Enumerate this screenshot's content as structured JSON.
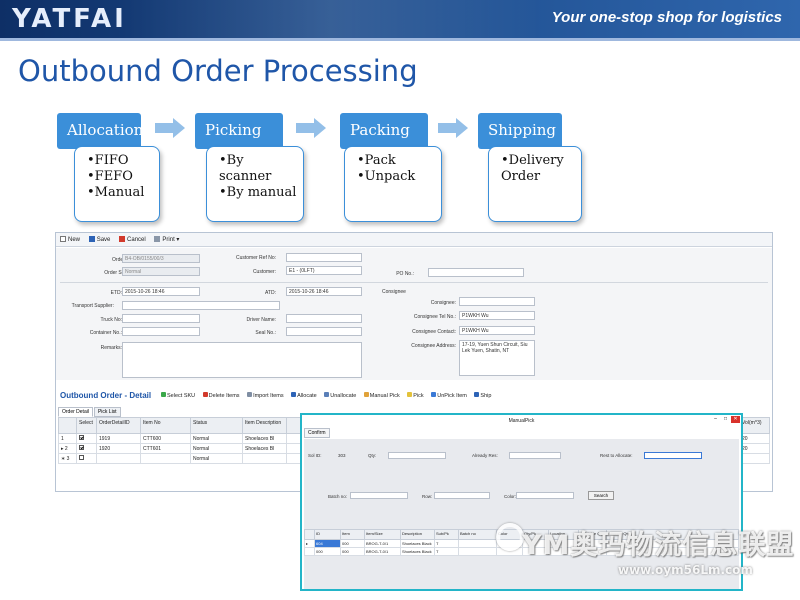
{
  "header": {
    "logo": "YATFAI",
    "tagline": "Your one-stop shop for logistics"
  },
  "page_title": "Outbound Order Processing",
  "stages": [
    {
      "title": "Allocation",
      "items": [
        "FIFO",
        "FEFO",
        "Manual"
      ]
    },
    {
      "title": "Picking",
      "items": [
        "By scanner",
        "By manual"
      ]
    },
    {
      "title": "Packing",
      "items": [
        "Pack",
        "Unpack"
      ]
    },
    {
      "title": "Shipping",
      "items": [
        "Delivery Order"
      ]
    }
  ],
  "window": {
    "toolbar": {
      "new": "New",
      "save": "Save",
      "cancel": "Cancel",
      "print": "Print"
    },
    "form": {
      "order_no_label": "Order No:",
      "order_no": "B4-OB/0155/00/3",
      "customer_ref_label": "Customer Ref No:",
      "customer_ref": "",
      "order_status_label": "Order Status:",
      "order_status": "Normal",
      "customer_label": "Customer:",
      "customer": "E1 - (0LFT)",
      "po_label": "PO No.:",
      "po": "",
      "etd_label": "ETD:",
      "etd": "2015-10-26 18:46",
      "atd_label": "ATD:",
      "atd": "2015-10-26 18:46",
      "transport_label": "Transport Supplier:",
      "transport": "",
      "truck_label": "Truck No:",
      "truck": "",
      "driver_label": "Driver Name:",
      "driver": "",
      "container_label": "Container No.:",
      "container": "",
      "seal_label": "Seal No.:",
      "seal": "",
      "remarks_label": "Remarks:",
      "remarks": "",
      "consignee_section": "Consignee",
      "consignee_label": "Consignee:",
      "consignee": "",
      "consignee_tel_label": "Consignee Tel No.:",
      "consignee_tel": "P1WKH Wu",
      "consignee_contact_label": "Consignee Contact:",
      "consignee_contact": "P1WKH Wu",
      "consignee_addr_label": "Consignee Address:",
      "consignee_addr": "17-19, Yuen Shun Circuit, Siu Lek Yuen, Shatin, NT"
    },
    "detail": {
      "title": "Outbound Order - Detail",
      "tools": [
        "Select SKU",
        "Delete Items",
        "Import Items",
        "Allocate",
        "Unallocate",
        "Manual Pick",
        "Pick",
        "UnPick Item",
        "Ship"
      ],
      "tabs": [
        "Order Detail",
        "Pick List"
      ],
      "columns": [
        "",
        "Select",
        "OrderDetailID",
        "Item No",
        "Status",
        "Item Description",
        "Vol(m^3)"
      ],
      "rows": [
        {
          "num": "1",
          "checked": true,
          "id": "1919",
          "item": "CTT600",
          "status": "Normal",
          "desc": "Shoelaces Bl",
          "vol": "20"
        },
        {
          "num": "2",
          "checked": true,
          "id": "1920",
          "item": "CTT601",
          "status": "Normal",
          "desc": "Shoelaces Bl",
          "vol": "20"
        },
        {
          "num": "3",
          "checked": false,
          "id": "",
          "item": "",
          "status": "Normal",
          "desc": "",
          "vol": ""
        }
      ]
    }
  },
  "dialog": {
    "title": "ManualPick",
    "confirm": "Confirm",
    "labels": {
      "sol": "Sol ID:",
      "sol_val": "303",
      "qty_label": "Qty:",
      "reserve_label": "Already Res:",
      "rest_label": "Rest to Allocate:",
      "batch": "Batch no:",
      "row_label": "Row:",
      "color": "Color:",
      "search": "Search"
    },
    "columns": [
      "",
      "ID",
      "Item",
      "Item/Size",
      "Description",
      "Sub/Pk",
      "Batch no",
      "Color",
      "Qty/Pk",
      "Location",
      "Available Qty",
      "Allocate Qty"
    ],
    "rows": [
      {
        "id": "604",
        "item": "000",
        "size": "BROG-T-0/1",
        "desc": "Shoelaces Black",
        "pk": "T"
      },
      {
        "id": "000",
        "item": "000",
        "size": "BROG-T-0/1",
        "desc": "Shoelaces Black",
        "pk": "T"
      }
    ]
  },
  "watermark": {
    "brand": "YM奥玛物流信息联盟",
    "url": "www.oym56Lm.com"
  },
  "colors": {
    "banner": "#1d4c8c",
    "accent": "#3b8fd9",
    "title": "#1f56a8",
    "dialog_border": "#23b5c8"
  }
}
